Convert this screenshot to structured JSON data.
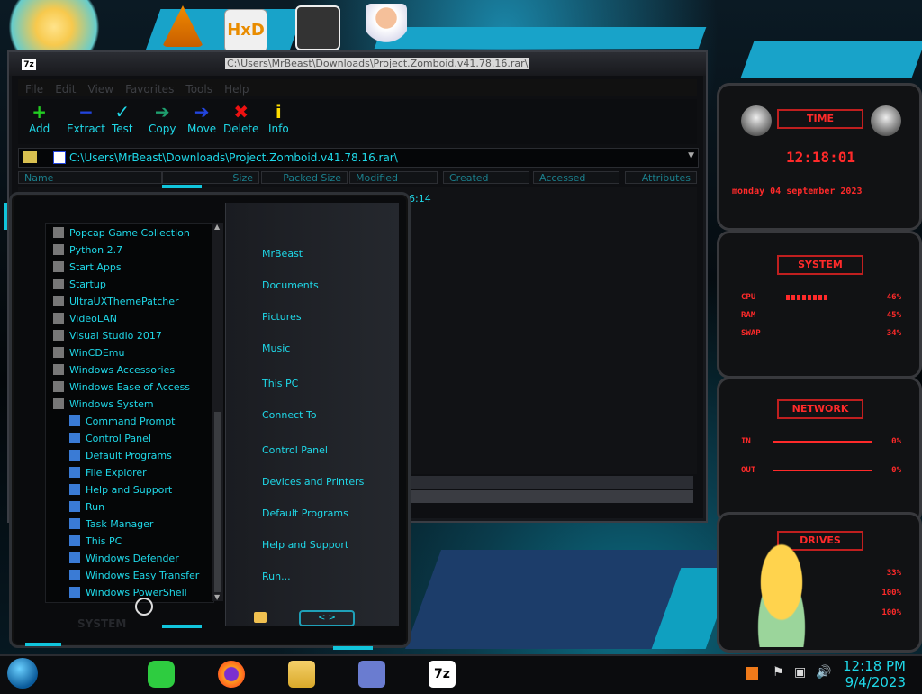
{
  "window": {
    "app_badge": "7z",
    "title": "C:\\Users\\MrBeast\\Downloads\\Project.Zomboid.v41.78.16.rar\\",
    "menu": [
      "File",
      "Edit",
      "View",
      "Favorites",
      "Tools",
      "Help"
    ],
    "toolbar": [
      {
        "label": "Add",
        "icon": "plus-icon",
        "glyph": "+",
        "color": "#22cc22"
      },
      {
        "label": "Extract",
        "icon": "minus-icon",
        "glyph": "−",
        "color": "#2244dd"
      },
      {
        "label": "Test",
        "icon": "check-icon",
        "glyph": "✓",
        "color": "#1fd8e8"
      },
      {
        "label": "Copy",
        "icon": "copy-arrow-icon",
        "glyph": "➔",
        "color": "#1e9e6e"
      },
      {
        "label": "Move",
        "icon": "move-arrow-icon",
        "glyph": "➔",
        "color": "#2244dd"
      },
      {
        "label": "Delete",
        "icon": "delete-x-icon",
        "glyph": "✖",
        "color": "#ee1111"
      },
      {
        "label": "Info",
        "icon": "info-icon",
        "glyph": "i",
        "color": "#ffdd00"
      }
    ],
    "address": "C:\\Users\\MrBeast\\Downloads\\Project.Zomboid.v41.78.16.rar\\",
    "columns": [
      "Name",
      "Size",
      "Packed Size",
      "Modified",
      "Created",
      "Accessed",
      "Attributes"
    ],
    "row_fragment": "6:14"
  },
  "startmenu": {
    "programs": [
      {
        "label": "Popcap Game Collection",
        "type": "folder"
      },
      {
        "label": "Python 2.7",
        "type": "folder"
      },
      {
        "label": "Start Apps",
        "type": "folder"
      },
      {
        "label": "Startup",
        "type": "folder"
      },
      {
        "label": "UltraUXThemePatcher",
        "type": "folder"
      },
      {
        "label": "VideoLAN",
        "type": "folder"
      },
      {
        "label": "Visual Studio 2017",
        "type": "folder"
      },
      {
        "label": "WinCDEmu",
        "type": "folder"
      },
      {
        "label": "Windows Accessories",
        "type": "folder"
      },
      {
        "label": "Windows Ease of Access",
        "type": "folder"
      },
      {
        "label": "Windows System",
        "type": "folder"
      },
      {
        "label": "Command Prompt",
        "type": "app"
      },
      {
        "label": "Control Panel",
        "type": "app"
      },
      {
        "label": "Default Programs",
        "type": "app"
      },
      {
        "label": "File Explorer",
        "type": "app"
      },
      {
        "label": "Help and Support",
        "type": "app"
      },
      {
        "label": "Run",
        "type": "app"
      },
      {
        "label": "Task Manager",
        "type": "app"
      },
      {
        "label": "This PC",
        "type": "app"
      },
      {
        "label": "Windows Defender",
        "type": "app"
      },
      {
        "label": "Windows Easy Transfer",
        "type": "app"
      },
      {
        "label": "Windows PowerShell",
        "type": "app"
      }
    ],
    "right_items": [
      "MrBeast",
      "Documents",
      "Pictures",
      "Music",
      "This PC",
      "Connect To",
      "Control Panel",
      "Devices and Printers",
      "Default Programs",
      "Help and Support",
      "Run..."
    ],
    "bottom_label": "SYSTEM"
  },
  "gadgets": {
    "time": {
      "header": "TIME",
      "clock": "12:18:01",
      "date": "monday 04 september 2023"
    },
    "system": {
      "header": "SYSTEM",
      "rows": [
        {
          "label": "CPU",
          "value": "46%"
        },
        {
          "label": "RAM",
          "value": "45%"
        },
        {
          "label": "SWAP",
          "value": "34%"
        }
      ]
    },
    "network": {
      "header": "NETWORK",
      "rows": [
        {
          "label": "IN",
          "value": "0%"
        },
        {
          "label": "OUT",
          "value": "0%"
        }
      ]
    },
    "drives": {
      "header": "DRIVES",
      "rows": [
        {
          "value": "33%"
        },
        {
          "value": "100%"
        },
        {
          "value": "100%"
        }
      ]
    }
  },
  "taskbar": {
    "time": "12:18 PM",
    "date": "9/4/2023",
    "pinned": [
      "start-orb-icon",
      "notes-icon",
      "firefox-icon",
      "file-explorer-icon",
      "app-window-icon",
      "7zip-icon"
    ],
    "tray": [
      "flag-icon",
      "network-icon",
      "volume-icon"
    ]
  },
  "colors": {
    "accent": "#1fd8e8",
    "alert": "#ff2a2a"
  }
}
